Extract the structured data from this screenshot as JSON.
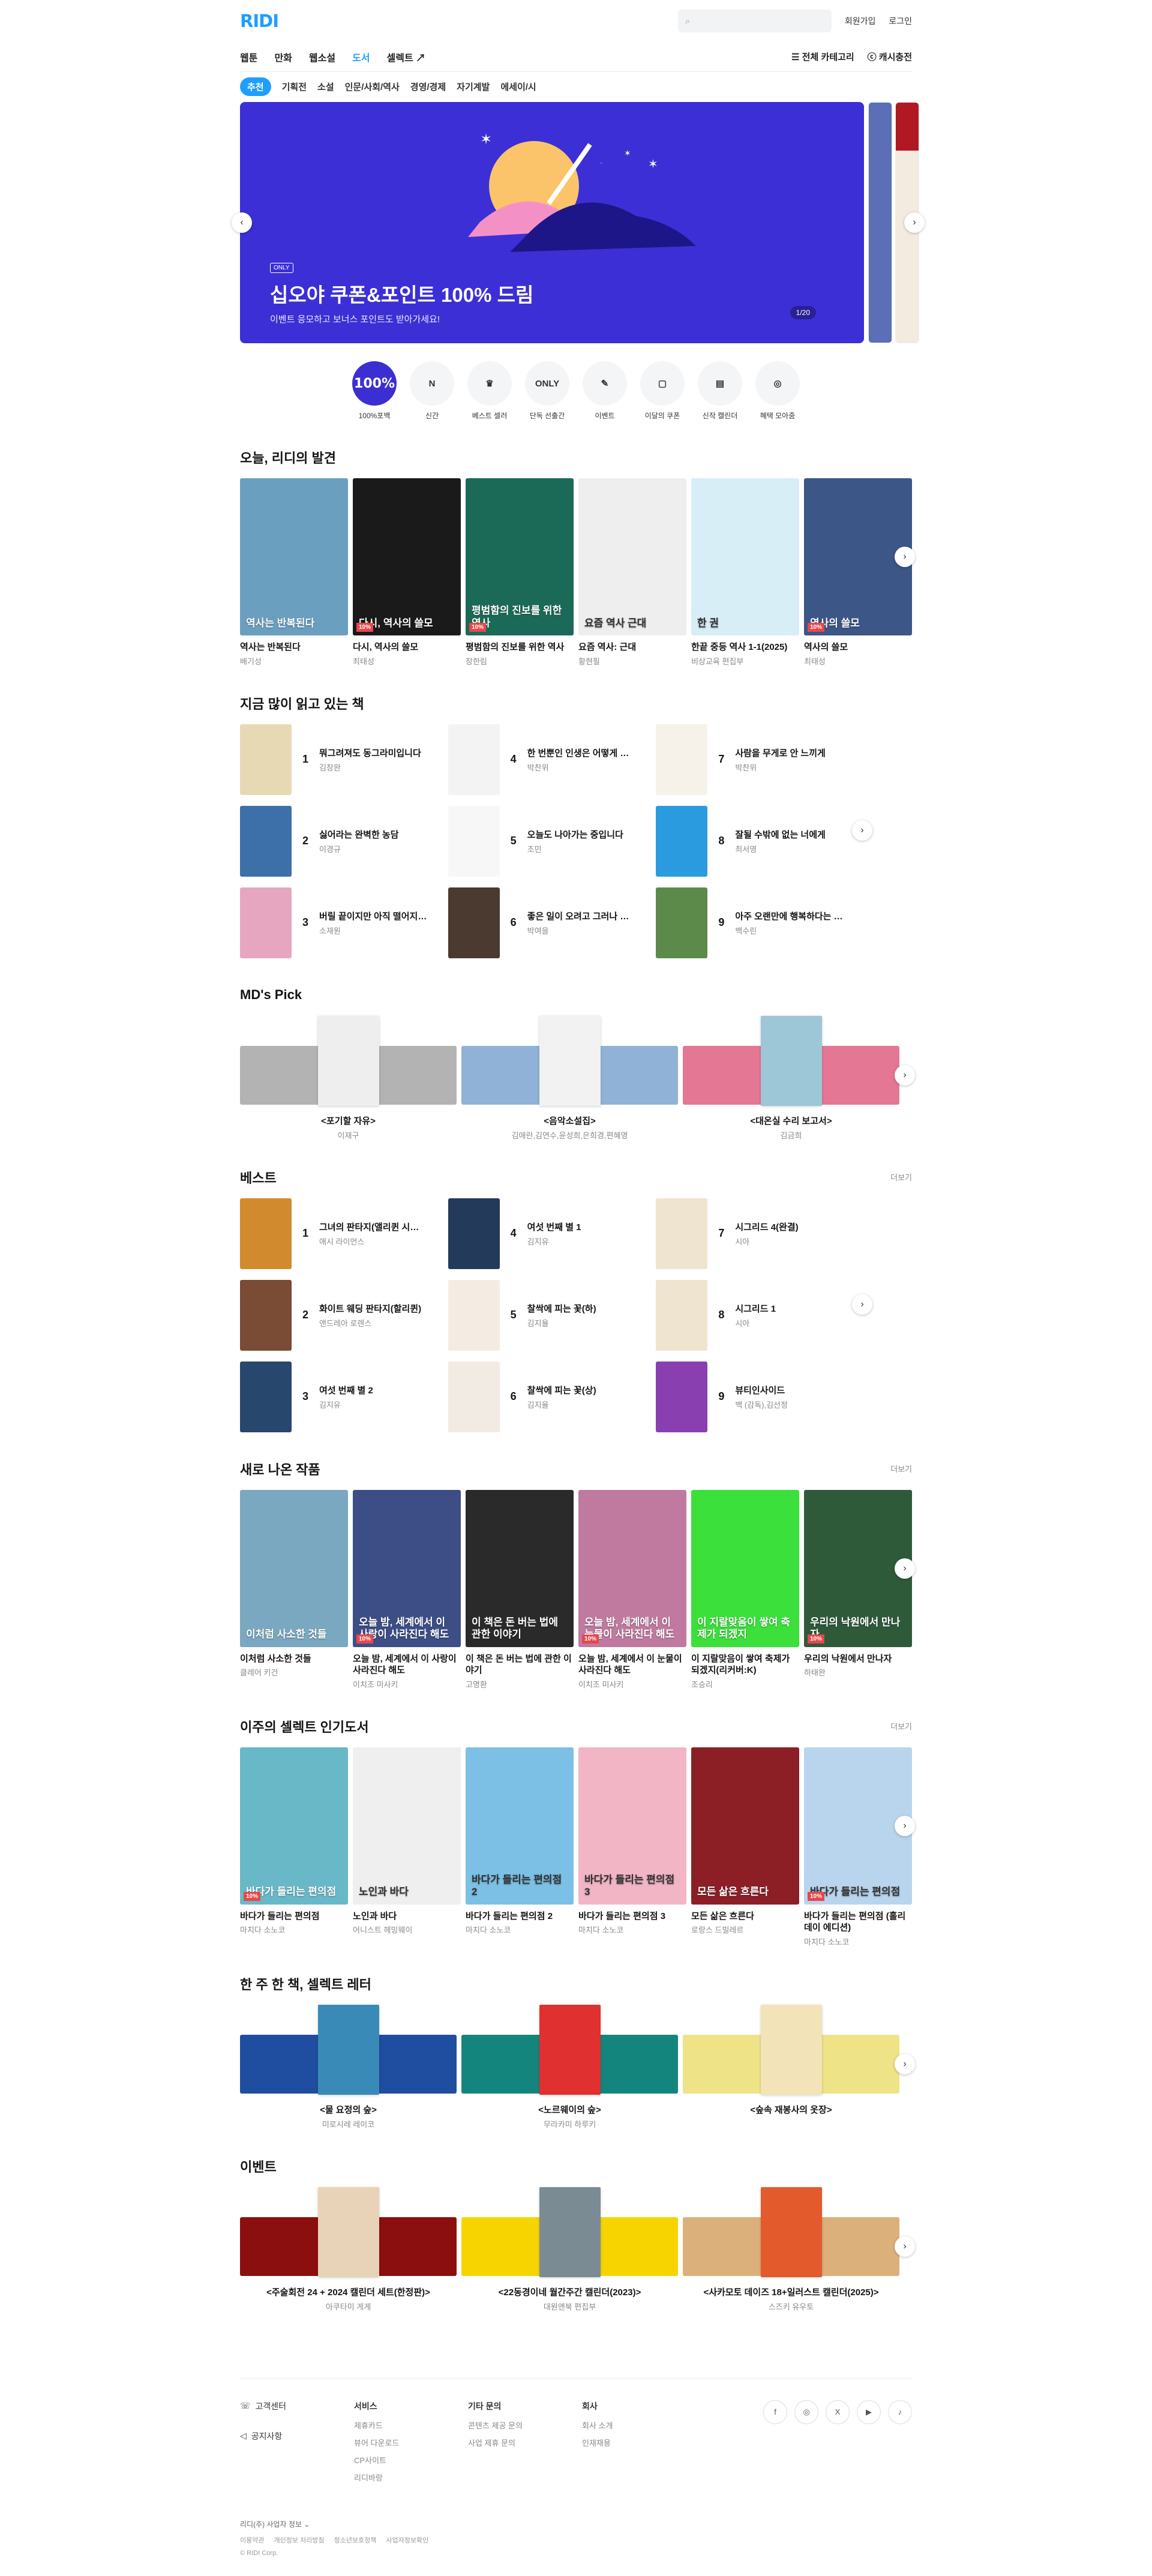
{
  "header": {
    "logo": "RIDI",
    "search_placeholder": "",
    "signup": "회원가입",
    "login": "로그인"
  },
  "gnb": {
    "tabs": [
      {
        "label": "웹툰"
      },
      {
        "label": "만화"
      },
      {
        "label": "웹소설"
      },
      {
        "label": "도서"
      },
      {
        "label": "셀렉트"
      }
    ],
    "categories": "전체 카테고리",
    "cash": "캐시충전"
  },
  "subtabs": [
    "추천",
    "기획전",
    "소설",
    "인문/사회/역사",
    "경영/경제",
    "자기계발",
    "에세이/시"
  ],
  "banner": {
    "chip": "ONLY",
    "title": "십오야 쿠폰&포인트 100% 드림",
    "desc": "이벤트 응모하고 보너스 포인트도 받아가세요!",
    "counter": "1/20",
    "bg": "#3c2fd6"
  },
  "quick": [
    {
      "icon": "100%",
      "label": "100%포백"
    },
    {
      "icon": "N",
      "label": "신간"
    },
    {
      "icon": "♛",
      "label": "베스트 셀러"
    },
    {
      "icon": "ONLY",
      "label": "단독 선출간"
    },
    {
      "icon": "✎",
      "label": "이벤트"
    },
    {
      "icon": "▢",
      "label": "이달의 쿠폰"
    },
    {
      "icon": "▤",
      "label": "신작 캘린더"
    },
    {
      "icon": "◎",
      "label": "혜택 모아줌"
    }
  ],
  "discover": {
    "title": "오늘, 리디의 발견",
    "books": [
      {
        "cover": "역사는 반복된다",
        "title": "역사는 반복된다",
        "author": "배기성",
        "color": "#6a9fc0"
      },
      {
        "cover": "다시, 역사의 쓸모",
        "title": "다시, 역사의 쓸모",
        "author": "최태성",
        "color": "#1a1a1a",
        "badge": "10%"
      },
      {
        "cover": "평범함의 진보를 위한 역사",
        "title": "평범함의 진보를 위한 역사",
        "author": "장한림",
        "color": "#1b6a58",
        "badge": "10%"
      },
      {
        "cover": "요즘 역사 근대",
        "title": "요즘 역사: 근대",
        "author": "황현필",
        "color": "#eeeeee"
      },
      {
        "cover": "한 권",
        "title": "한끝 중등 역사 1-1(2025)",
        "author": "비상교육 편집부",
        "color": "#d8eef7"
      },
      {
        "cover": "역사의 쓸모",
        "title": "역사의 쓸모",
        "author": "최태성",
        "color": "#3b5687",
        "badge": "10%"
      }
    ]
  },
  "popular": {
    "title": "지금 많이 읽고 있는 책",
    "items": [
      {
        "rank": "1",
        "title": "뭐그려져도 동그라미입니다",
        "author": "김창완",
        "color": "#e8d9b5"
      },
      {
        "rank": "4",
        "title": "한 번뿐인 인생은 어떻게 살까",
        "author": "박찬위",
        "color": "#f3f3f3"
      },
      {
        "rank": "7",
        "title": "사람을 무게로 안 느끼게",
        "author": "박찬위",
        "color": "#f6f2ea"
      },
      {
        "rank": "2",
        "title": "싫어라는 완벽한 농담",
        "author": "이경규",
        "color": "#3d6fa8"
      },
      {
        "rank": "5",
        "title": "오늘도 나아가는 중입니다",
        "author": "조민",
        "color": "#f7f7f7"
      },
      {
        "rank": "8",
        "title": "잘될 수밖에 없는 너에게",
        "author": "최서영",
        "color": "#2b9be0"
      },
      {
        "rank": "3",
        "title": "버릴 끝이지만 아직 떨어지지 않았다",
        "author": "소재원",
        "color": "#e7a6c0"
      },
      {
        "rank": "6",
        "title": "좋은 일이 오려고 그러나 보다",
        "author": "박여을",
        "color": "#4a3a30"
      },
      {
        "rank": "9",
        "title": "아주 오랜만에 행복하다는 느낌",
        "author": "백수린",
        "color": "#5b8a4a"
      }
    ]
  },
  "md": {
    "title": "MD's Pick",
    "items": [
      {
        "title": "<포기할 자유>",
        "author": "이재구",
        "band": "#b3b3b3",
        "cover": "#eeeeee"
      },
      {
        "title": "<음악소설집>",
        "author": "김애란,김연수,윤성희,은희경,편혜영",
        "band": "#90b2d6",
        "cover": "#f2f2f2"
      },
      {
        "title": "<대온실 수리 보고서>",
        "author": "김금희",
        "band": "#e47793",
        "cover": "#9dc7d6"
      }
    ]
  },
  "best": {
    "title": "베스트",
    "more": "더보기",
    "items": [
      {
        "rank": "1",
        "title": "그녀의 판타지(앨리퀸 시리즈)",
        "author": "애시 라이언스",
        "color": "#d28a2e"
      },
      {
        "rank": "4",
        "title": "여섯 번째 별 1",
        "author": "김지유",
        "color": "#243a5a"
      },
      {
        "rank": "7",
        "title": "시그리드 4(완결)",
        "author": "시아",
        "color": "#efe4cf"
      },
      {
        "rank": "2",
        "title": "화이트 웨딩 판타지(할리퀸)",
        "author": "앤드레아 로렌스",
        "color": "#7a4b35"
      },
      {
        "rank": "5",
        "title": "찰싹에 피는 꽃(하)",
        "author": "김지율",
        "color": "#f4ece2"
      },
      {
        "rank": "8",
        "title": "시그리드 1",
        "author": "시아",
        "color": "#efe4cf"
      },
      {
        "rank": "3",
        "title": "여섯 번째 별 2",
        "author": "김지유",
        "color": "#28476c"
      },
      {
        "rank": "6",
        "title": "찰싹에 피는 꽃(상)",
        "author": "김지율",
        "color": "#f2ebe3"
      },
      {
        "rank": "9",
        "title": "뷰티인사이드",
        "author": "백 (감독),김선정",
        "color": "#8a3fb0"
      }
    ]
  },
  "newbooks": {
    "title": "새로 나온 작품",
    "more": "더보기",
    "books": [
      {
        "cover": "이처럼 사소한 것들",
        "title": "이처럼 사소한 것들",
        "author": "클레어 키건",
        "color": "#7aa8c0"
      },
      {
        "cover": "오늘 밤, 세계에서 이 사랑이 사라진다 해도",
        "title": "오늘 밤, 세계에서 이 사랑이 사라진다 해도",
        "author": "이치조 미사키",
        "color": "#3d4e86",
        "badge": "10%"
      },
      {
        "cover": "이 책은 돈 버는 법에 관한 이야기",
        "title": "이 책은 돈 버는 법에 관한 이야기",
        "author": "고명환",
        "color": "#2a2a2a"
      },
      {
        "cover": "오늘 밤, 세계에서 이 눈물이 사라진다 해도",
        "title": "오늘 밤, 세계에서 이 눈물이 사라진다 해도",
        "author": "이치조 미사키",
        "color": "#c07aa0",
        "badge": "10%"
      },
      {
        "cover": "이 지랄맞음이 쌓여 축제가 되겠지",
        "title": "이 지랄맞음이 쌓여 축제가 되겠지(리커버:K)",
        "author": "조승리",
        "color": "#3be03b"
      },
      {
        "cover": "우리의 낙원에서 만나자",
        "title": "우리의 낙원에서 만나자",
        "author": "하태완",
        "color": "#2f5a3a",
        "badge": "10%"
      }
    ]
  },
  "select": {
    "title": "이주의 셀렉트 인기도서",
    "more": "더보기",
    "books": [
      {
        "cover": "바다가 들리는 편의점",
        "title": "바다가 들리는 편의점",
        "author": "마치다 소노코",
        "color": "#69b8c8",
        "badge": "10%"
      },
      {
        "cover": "노인과 바다",
        "title": "노인과 바다",
        "author": "어니스트 헤밍웨이",
        "color": "#efefef"
      },
      {
        "cover": "바다가 들리는 편의점 2",
        "title": "바다가 들리는 편의점 2",
        "author": "마치다 소노코",
        "color": "#7cc0e6"
      },
      {
        "cover": "바다가 들리는 편의점 3",
        "title": "바다가 들리는 편의점 3",
        "author": "마치다 소노코",
        "color": "#f2b5c6"
      },
      {
        "cover": "모든 삶은 흐른다",
        "title": "모든 삶은 흐른다",
        "author": "로랑스 드빌레르",
        "color": "#8c1f26"
      },
      {
        "cover": "바다가 들리는 편의점",
        "title": "바다가 들리는 편의점 (홀리데이 에디션)",
        "author": "마치다 소노코",
        "color": "#b9d5ee",
        "badge": "10%"
      }
    ]
  },
  "letter": {
    "title": "한 주 한 책, 셀렉트 레터",
    "items": [
      {
        "title": "<물 요정의 숲>",
        "author": "미로시레 레이코",
        "band": "#1f4ea0",
        "cover": "#3a8ab8"
      },
      {
        "title": "<노르웨이의 숲>",
        "author": "무라카미 하루키",
        "band": "#14857c",
        "cover": "#e03030"
      },
      {
        "title": "<숲속 재봉사의 옷장>",
        "author": "",
        "band": "#efe387",
        "cover": "#f2e3b8"
      }
    ]
  },
  "events": {
    "title": "이벤트",
    "items": [
      {
        "title": "<주술회전 24 + 2024 캘린더 세트(한정판)>",
        "author": "아쿠타미 게게",
        "band": "#8c0f0f",
        "cover": "#e8d2b8"
      },
      {
        "title": "<22동경이네 월간주간 캘린더(2023)>",
        "author": "대원앤북 편집부",
        "band": "#f7d400",
        "cover": "#7b8b94"
      },
      {
        "title": "<사카모토 데이즈 18+일러스트 캘린더(2025)>",
        "author": "스즈키 유우토",
        "band": "#dcb07a",
        "cover": "#e35a2c"
      }
    ]
  },
  "footer": {
    "cs": "고객센터",
    "notice": "공지사항",
    "cols": [
      {
        "head": "서비스",
        "links": [
          "제휴카드",
          "뷰어 다운로드",
          "CP사이트",
          "리디바랑"
        ]
      },
      {
        "head": "기타 문의",
        "links": [
          "콘텐츠 제공 문의",
          "사업 제휴 문의"
        ]
      },
      {
        "head": "회사",
        "links": [
          "회사 소개",
          "인재채용"
        ]
      }
    ],
    "social": [
      "f",
      "◎",
      "X",
      "▶",
      "♪"
    ],
    "info": "리디(주) 사업자 정보 ⌄",
    "legal": [
      "이용약관",
      "개인정보 처리방침",
      "청소년보호정책",
      "사업자정보확인"
    ],
    "copyright": "© RIDI Corp."
  }
}
